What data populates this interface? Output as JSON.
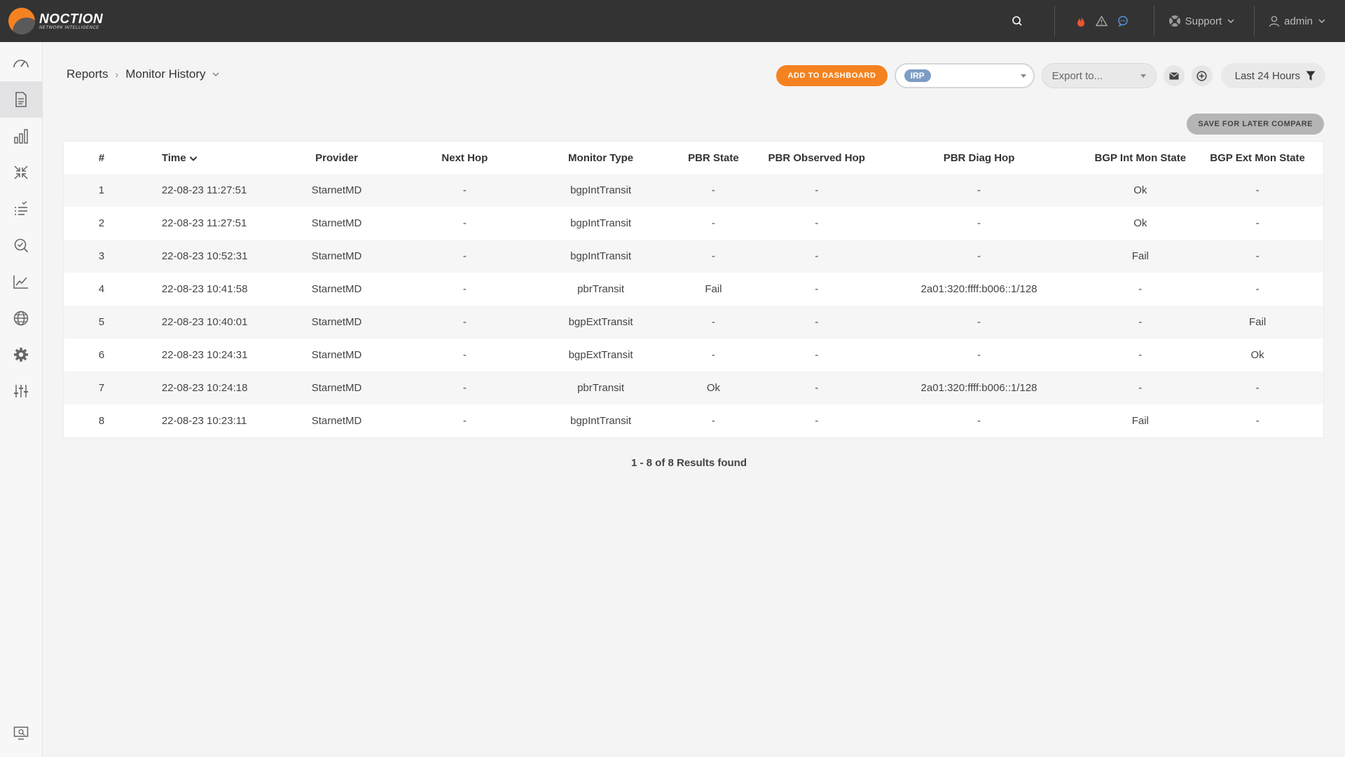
{
  "app": {
    "logo_name": "NOCTION",
    "logo_tagline": "NETWORK INTELLIGENCE"
  },
  "topbar": {
    "support_label": "Support",
    "user_label": "admin"
  },
  "breadcrumb": {
    "root": "Reports",
    "current": "Monitor History"
  },
  "toolbar": {
    "add_to_dashboard": "ADD TO DASHBOARD",
    "irp_chip": "IRP",
    "export_placeholder": "Export to...",
    "range_label": "Last 24 Hours",
    "save_compare": "SAVE FOR LATER COMPARE"
  },
  "table": {
    "headers": [
      "#",
      "Time",
      "Provider",
      "Next Hop",
      "Monitor Type",
      "PBR State",
      "PBR Observed Hop",
      "PBR Diag Hop",
      "BGP Int Mon State",
      "BGP Ext Mon State"
    ],
    "rows": [
      [
        "1",
        "22-08-23 11:27:51",
        "StarnetMD",
        "-",
        "bgpIntTransit",
        "-",
        "-",
        "-",
        "Ok",
        "-"
      ],
      [
        "2",
        "22-08-23 11:27:51",
        "StarnetMD",
        "-",
        "bgpIntTransit",
        "-",
        "-",
        "-",
        "Ok",
        "-"
      ],
      [
        "3",
        "22-08-23 10:52:31",
        "StarnetMD",
        "-",
        "bgpIntTransit",
        "-",
        "-",
        "-",
        "Fail",
        "-"
      ],
      [
        "4",
        "22-08-23 10:41:58",
        "StarnetMD",
        "-",
        "pbrTransit",
        "Fail",
        "-",
        "2a01:320:ffff:b006::1/128",
        "-",
        "-"
      ],
      [
        "5",
        "22-08-23 10:40:01",
        "StarnetMD",
        "-",
        "bgpExtTransit",
        "-",
        "-",
        "-",
        "-",
        "Fail"
      ],
      [
        "6",
        "22-08-23 10:24:31",
        "StarnetMD",
        "-",
        "bgpExtTransit",
        "-",
        "-",
        "-",
        "-",
        "Ok"
      ],
      [
        "7",
        "22-08-23 10:24:18",
        "StarnetMD",
        "-",
        "pbrTransit",
        "Ok",
        "-",
        "2a01:320:ffff:b006::1/128",
        "-",
        "-"
      ],
      [
        "8",
        "22-08-23 10:23:11",
        "StarnetMD",
        "-",
        "bgpIntTransit",
        "-",
        "-",
        "-",
        "Fail",
        "-"
      ]
    ],
    "results_text": "1 - 8 of 8 Results found"
  },
  "sidebar": {
    "items": [
      "dashboard-icon",
      "reports-icon",
      "bar-chart-icon",
      "collapse-icon",
      "checklist-icon",
      "search-check-icon",
      "line-chart-icon",
      "globe-icon",
      "gear-icon",
      "sliders-icon"
    ],
    "active": "reports-icon",
    "bottom": "monitor-search-icon"
  },
  "colors": {
    "topbar": "#333333",
    "accent": "#f58220",
    "chip": "#7d9cc4",
    "alert_fire": "#e8552f",
    "alert_chat": "#5b8fd6"
  }
}
